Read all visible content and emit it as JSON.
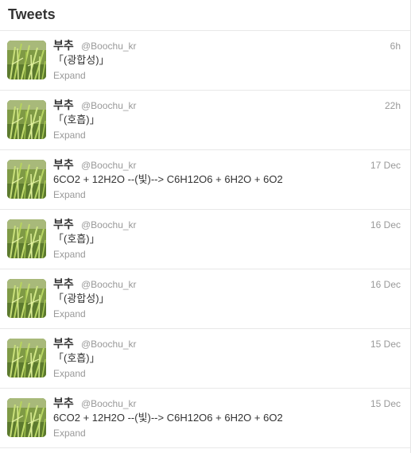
{
  "header": {
    "title": "Tweets"
  },
  "tweets": [
    {
      "fullname": "부추",
      "username": "@Boochu_kr",
      "time": "6h",
      "text": "「(광합성)」",
      "expand": "Expand"
    },
    {
      "fullname": "부추",
      "username": "@Boochu_kr",
      "time": "22h",
      "text": "「(호흡)」",
      "expand": "Expand"
    },
    {
      "fullname": "부추",
      "username": "@Boochu_kr",
      "time": "17 Dec",
      "text": "6CO2 + 12H2O --(빛)--> C6H12O6 + 6H2O + 6O2",
      "expand": "Expand"
    },
    {
      "fullname": "부추",
      "username": "@Boochu_kr",
      "time": "16 Dec",
      "text": "「(호흡)」",
      "expand": "Expand"
    },
    {
      "fullname": "부추",
      "username": "@Boochu_kr",
      "time": "16 Dec",
      "text": "「(광합성)」",
      "expand": "Expand"
    },
    {
      "fullname": "부추",
      "username": "@Boochu_kr",
      "time": "15 Dec",
      "text": "「(호흡)」",
      "expand": "Expand"
    },
    {
      "fullname": "부추",
      "username": "@Boochu_kr",
      "time": "15 Dec",
      "text": "6CO2 + 12H2O --(빛)--> C6H12O6 + 6H2O + 6O2",
      "expand": "Expand"
    }
  ],
  "colors": {
    "text": "#333333",
    "muted": "#999999",
    "divider": "#e8e8e8",
    "avatar_green": "#6a8a3a"
  },
  "icons": {
    "avatar": "chive-plant-avatar"
  }
}
